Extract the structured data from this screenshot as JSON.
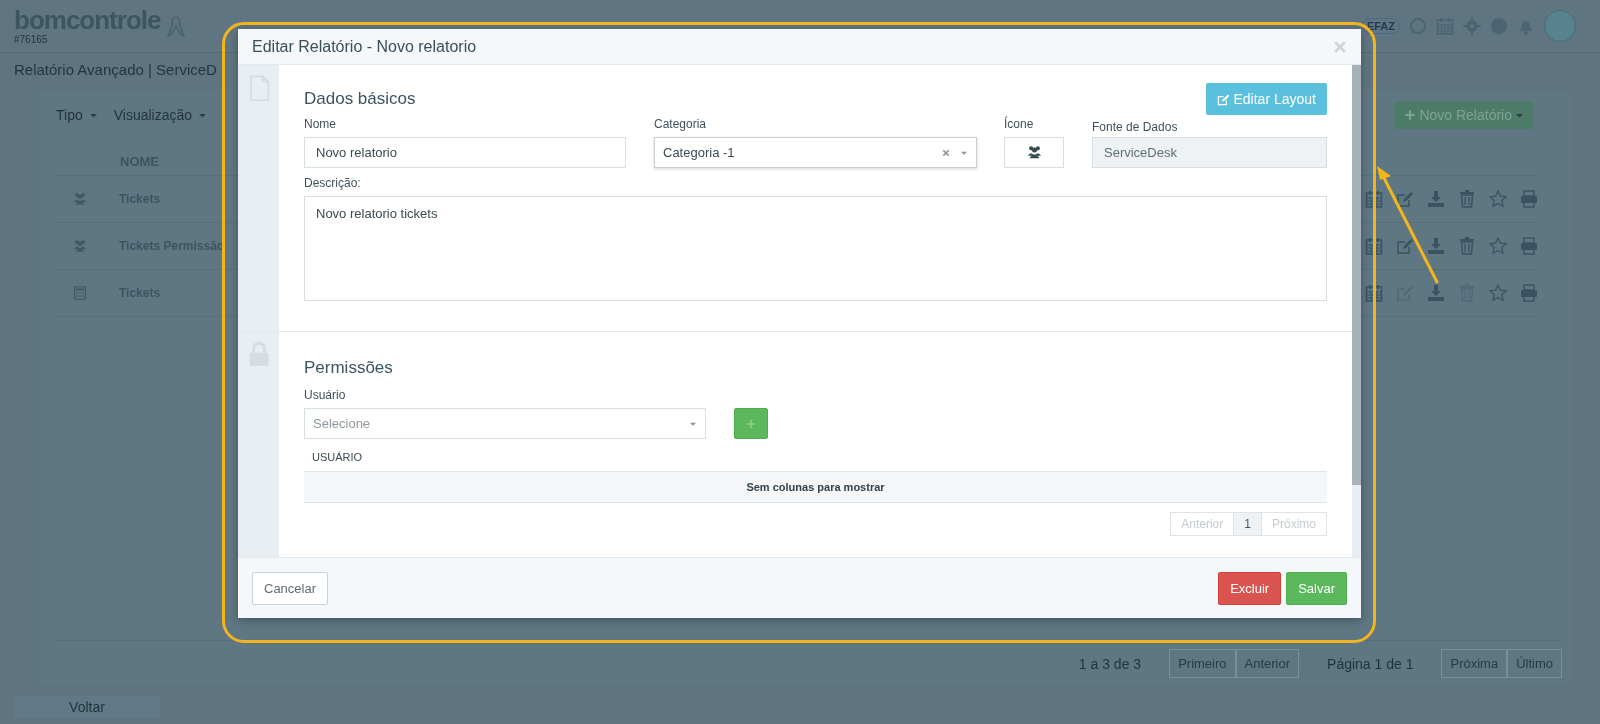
{
  "app": {
    "logo": "bomcontrole",
    "account": "#76165",
    "badge": "EFAZ"
  },
  "page_title": "Relatório Avançado | ServiceD",
  "filters": [
    {
      "label": "Tipo"
    },
    {
      "label": "Visualização"
    }
  ],
  "new_report_button": "Novo Relatório",
  "reports_table": {
    "columns": [
      "NOME"
    ],
    "rows": [
      {
        "kind": "group",
        "name": "Tickets",
        "editable": true
      },
      {
        "kind": "group",
        "name": "Tickets Permissão",
        "editable": true
      },
      {
        "kind": "calculator",
        "name": "Tickets",
        "editable": false
      }
    ]
  },
  "pagination": {
    "summary": "1 a 3 de 3",
    "before": [
      "Primeiro",
      "Anterior"
    ],
    "page_info": "Página 1 de 1",
    "after": [
      "Próxima",
      "Último"
    ]
  },
  "back_button": "Voltar",
  "modal": {
    "title": "Editar Relatório - Novo relatorio",
    "basic": {
      "title": "Dados básicos",
      "layout_button": "Editar Layout",
      "name": {
        "label": "Nome",
        "value": "Novo relatorio"
      },
      "category": {
        "label": "Categoria",
        "value": "Categoria -1"
      },
      "icon": {
        "label": "Ícone"
      },
      "source": {
        "label": "Fonte de Dados",
        "value": "ServiceDesk",
        "disabled": true
      },
      "description": {
        "label": "Descrição:",
        "value": "Novo relatorio tickets"
      }
    },
    "permissions": {
      "title": "Permissões",
      "user_label": "Usuário",
      "user_placeholder": "Selecione",
      "table": {
        "columns": [
          "USUÁRIO"
        ],
        "empty": "Sem colunas para mostrar"
      },
      "pagination": {
        "prev": "Anterior",
        "pages": [
          {
            "label": "1",
            "selected": true
          }
        ],
        "next": "Próximo"
      }
    },
    "footer": {
      "cancel": "Cancelar",
      "delete": "Excluir",
      "save": "Salvar"
    }
  }
}
